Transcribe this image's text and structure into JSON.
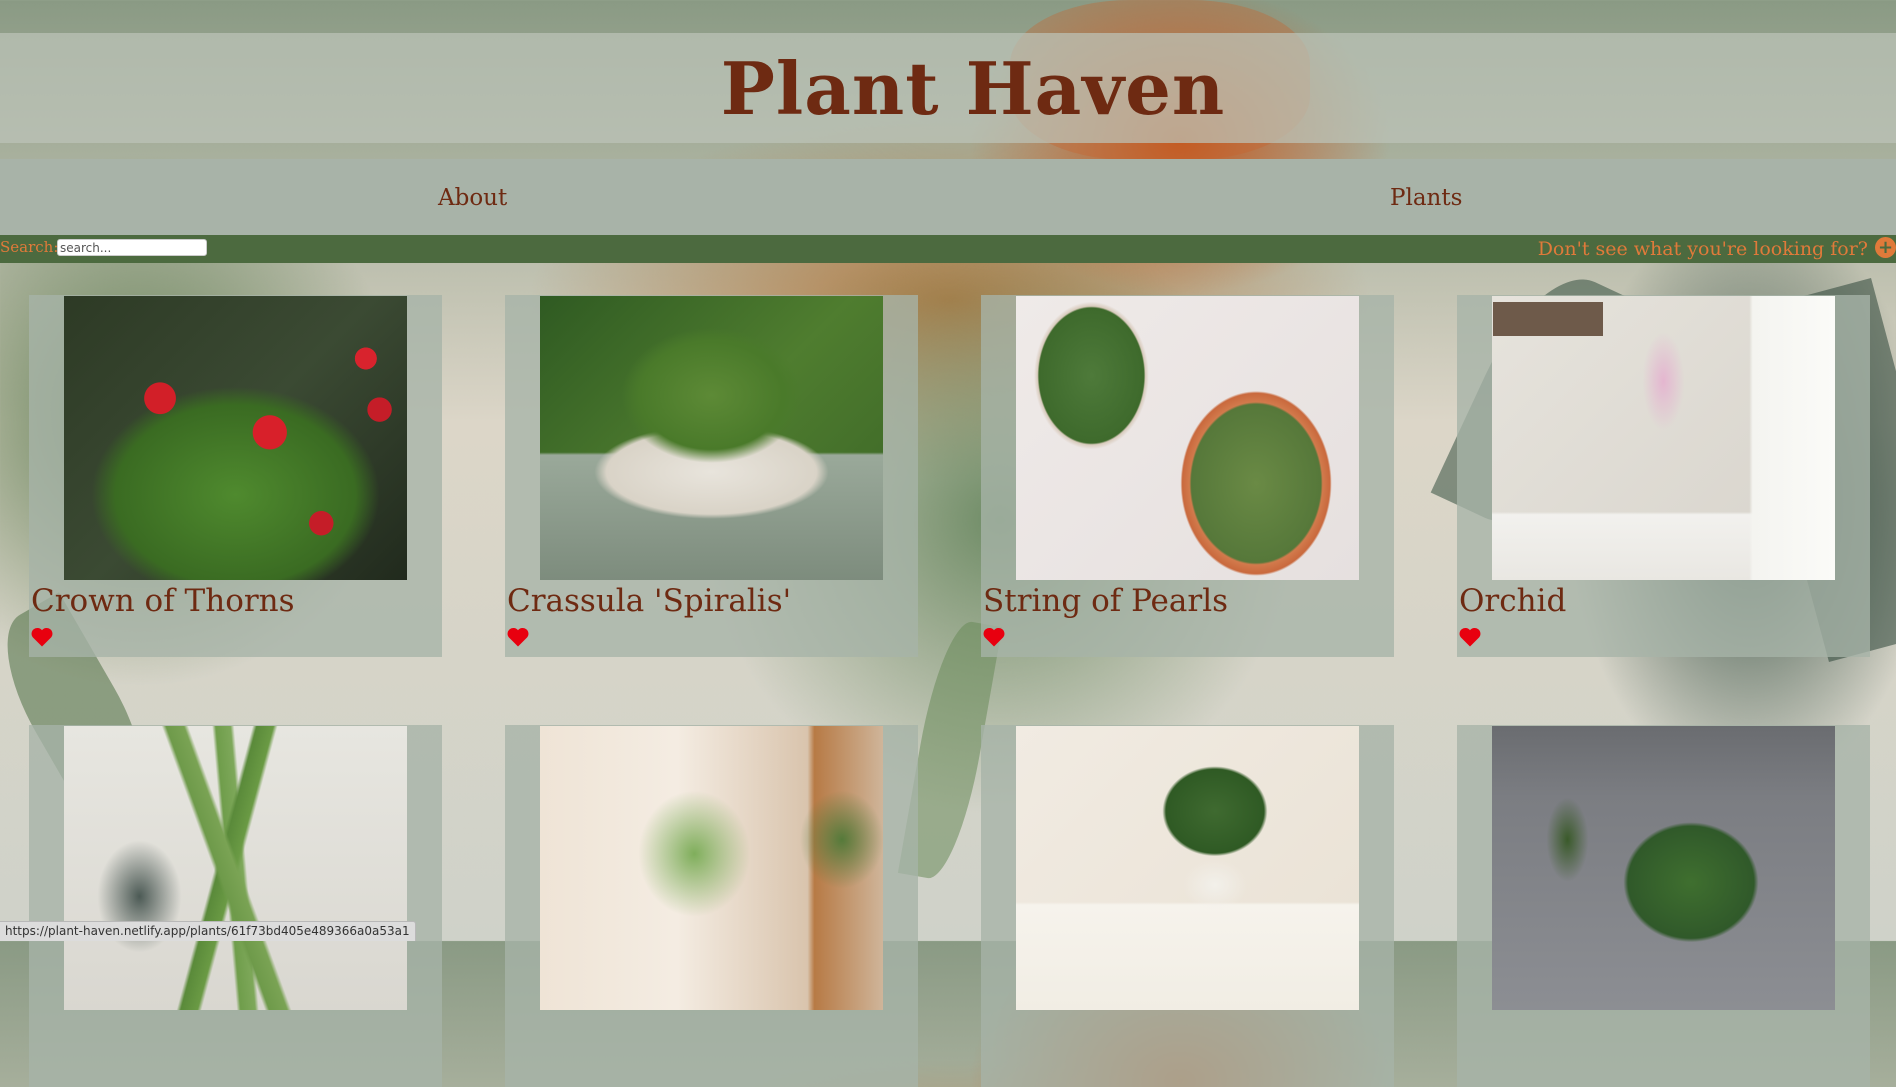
{
  "site": {
    "title": "Plant Haven"
  },
  "nav": {
    "about": "About",
    "plants": "Plants"
  },
  "search": {
    "label": "Search:",
    "placeholder": "search...",
    "value": "",
    "add_prompt": "Don't see what you're looking for?",
    "add_icon": "plus-circle-icon"
  },
  "plants": [
    {
      "name": "Crown of Thorns",
      "favorite_icon": "heart-icon"
    },
    {
      "name": "Crassula 'Spiralis'",
      "favorite_icon": "heart-icon"
    },
    {
      "name": "String of Pearls",
      "favorite_icon": "heart-icon"
    },
    {
      "name": "Orchid",
      "favorite_icon": "heart-icon"
    },
    {
      "name": "",
      "favorite_icon": "heart-icon"
    },
    {
      "name": "",
      "favorite_icon": "heart-icon"
    },
    {
      "name": "",
      "favorite_icon": "heart-icon"
    },
    {
      "name": "",
      "favorite_icon": "heart-icon"
    }
  ],
  "statusbar": {
    "url": "https://plant-haven.netlify.app/plants/61f73bd405e489366a0a53a1"
  },
  "colors": {
    "title": "#6e2a12",
    "accent": "#e07a3a",
    "search_bar": "#4c6a3f",
    "heart": "#e8000f"
  }
}
